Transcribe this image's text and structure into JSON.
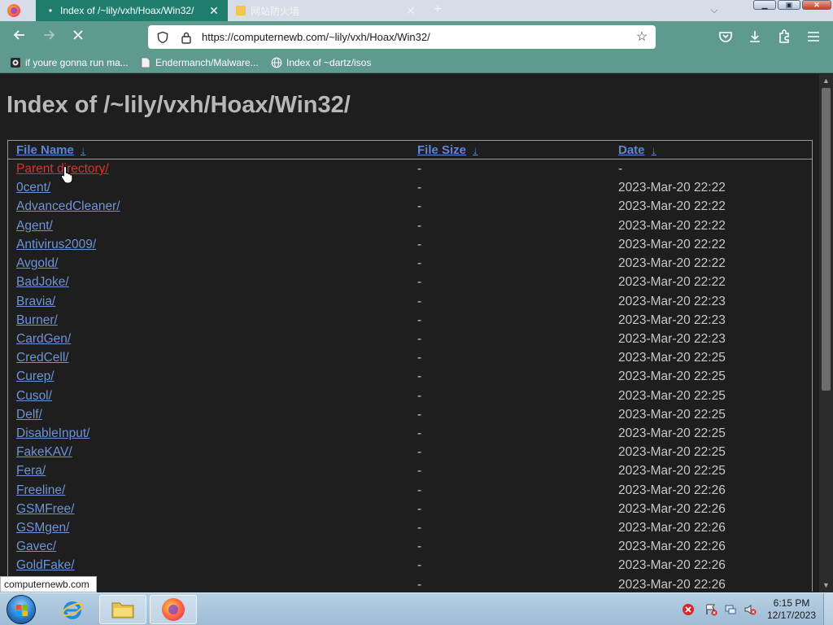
{
  "browser": {
    "tabs": [
      {
        "title": "Index of /~lily/vxh/Hoax/Win32/",
        "active": true,
        "icon": "loading-icon"
      },
      {
        "title": "网站防火墙",
        "active": false,
        "icon": "folder-icon"
      }
    ],
    "url": "https://computernewb.com/~lily/vxh/Hoax/Win32/",
    "bookmarks": [
      {
        "label": "if youre gonna run ma...",
        "icon": "bug-icon"
      },
      {
        "label": "Endermanch/Malware...",
        "icon": "page-icon"
      },
      {
        "label": "Index of ~dartz/isos",
        "icon": "globe-icon"
      }
    ],
    "status_link": "computernewb.com"
  },
  "page": {
    "title": "Index of /~lily/vxh/Hoax/Win32/",
    "columns": {
      "name": "File Name",
      "size": "File Size",
      "date": "Date",
      "sort_indicator": "↓"
    },
    "rows": [
      {
        "name": "Parent directory/",
        "size": "-",
        "date": "-"
      },
      {
        "name": "0cent/",
        "size": "-",
        "date": "2023-Mar-20 22:22"
      },
      {
        "name": "AdvancedCleaner/",
        "size": "-",
        "date": "2023-Mar-20 22:22"
      },
      {
        "name": "Agent/",
        "size": "-",
        "date": "2023-Mar-20 22:22"
      },
      {
        "name": "Antivirus2009/",
        "size": "-",
        "date": "2023-Mar-20 22:22"
      },
      {
        "name": "Avgold/",
        "size": "-",
        "date": "2023-Mar-20 22:22"
      },
      {
        "name": "BadJoke/",
        "size": "-",
        "date": "2023-Mar-20 22:22"
      },
      {
        "name": "Bravia/",
        "size": "-",
        "date": "2023-Mar-20 22:23"
      },
      {
        "name": "Burner/",
        "size": "-",
        "date": "2023-Mar-20 22:23"
      },
      {
        "name": "CardGen/",
        "size": "-",
        "date": "2023-Mar-20 22:23"
      },
      {
        "name": "CredCell/",
        "size": "-",
        "date": "2023-Mar-20 22:25"
      },
      {
        "name": "Curep/",
        "size": "-",
        "date": "2023-Mar-20 22:25"
      },
      {
        "name": "Cusol/",
        "size": "-",
        "date": "2023-Mar-20 22:25"
      },
      {
        "name": "Delf/",
        "size": "-",
        "date": "2023-Mar-20 22:25"
      },
      {
        "name": "DisableInput/",
        "size": "-",
        "date": "2023-Mar-20 22:25"
      },
      {
        "name": "FakeKAV/",
        "size": "-",
        "date": "2023-Mar-20 22:25"
      },
      {
        "name": "Fera/",
        "size": "-",
        "date": "2023-Mar-20 22:25"
      },
      {
        "name": "Freeline/",
        "size": "-",
        "date": "2023-Mar-20 22:26"
      },
      {
        "name": "GSMFree/",
        "size": "-",
        "date": "2023-Mar-20 22:26"
      },
      {
        "name": "GSMgen/",
        "size": "-",
        "date": "2023-Mar-20 22:26"
      },
      {
        "name": "Gavec/",
        "size": "-",
        "date": "2023-Mar-20 22:26"
      },
      {
        "name": "GoldFake/",
        "size": "-",
        "date": "2023-Mar-20 22:26"
      },
      {
        "name": "",
        "size": "-",
        "date": "2023-Mar-20 22:26"
      }
    ]
  },
  "taskbar": {
    "time": "6:15 PM",
    "date": "12/17/2023"
  },
  "colors": {
    "tab_active": "#1f7d6e",
    "toolbar": "#5f9a8f",
    "page_bg": "#1e1e1e",
    "link": "#6f93d8",
    "link_hover": "#e02e2e"
  }
}
